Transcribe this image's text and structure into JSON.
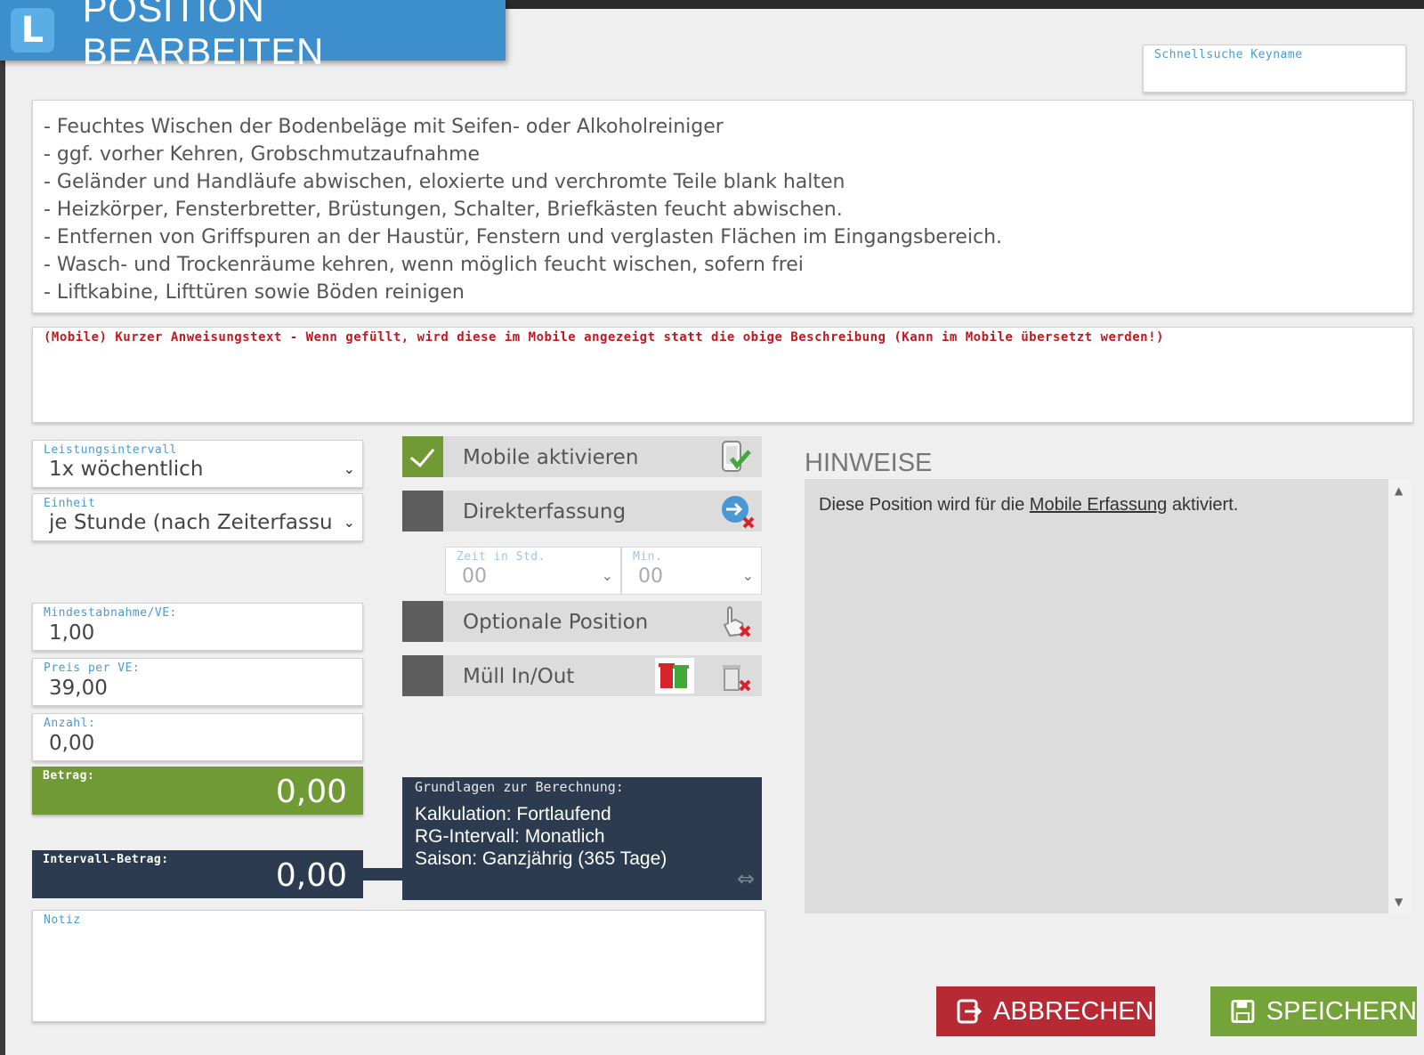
{
  "header": {
    "logo": "L",
    "title": "POSITION BEARBEITEN"
  },
  "search": {
    "label": "Schnellsuche Keyname",
    "value": ""
  },
  "description": {
    "lines": [
      "- Feuchtes Wischen der Bodenbeläge mit Seifen- oder Alkoholreiniger",
      "- ggf. vorher Kehren, Grobschmutzaufnahme",
      "- Geländer und Handläufe abwischen, eloxierte und verchromte Teile blank halten",
      "- Heizkörper, Fensterbretter, Brüstungen, Schalter, Briefkästen feucht abwischen.",
      "- Entfernen von Griffspuren an der Haustür, Fenstern und verglasten Flächen im Eingangsbereich.",
      "- Wasch- und Trockenräume kehren, wenn möglich feucht wischen, sofern frei",
      "- Liftkabine, Lifttüren sowie Böden reinigen"
    ]
  },
  "mobile_text": {
    "label": "(Mobile) Kurzer Anweisungstext - Wenn gefüllt, wird diese im Mobile angezeigt statt die obige Beschreibung (Kann im Mobile übersetzt werden!)",
    "value": ""
  },
  "form": {
    "leistungsintervall": {
      "label": "Leistungsintervall",
      "value": "1x wöchentlich"
    },
    "einheit": {
      "label": "Einheit",
      "value": "je Stunde (nach Zeiterfassur"
    },
    "mindestabnahme": {
      "label": "Mindestabnahme/VE:",
      "value": "1,00"
    },
    "preis": {
      "label": "Preis per VE:",
      "value": "39,00"
    },
    "anzahl": {
      "label": "Anzahl:",
      "value": "0,00"
    },
    "betrag": {
      "label": "Betrag:",
      "value": "0,00"
    },
    "intervall_betrag": {
      "label": "Intervall-Betrag:",
      "value": "0,00"
    },
    "notiz": {
      "label": "Notiz",
      "value": ""
    }
  },
  "toggles": {
    "mobile": {
      "label": "Mobile aktivieren",
      "checked": true
    },
    "direkt": {
      "label": "Direkterfassung",
      "checked": false
    },
    "optional": {
      "label": "Optionale Position",
      "checked": false
    },
    "muell": {
      "label": "Müll In/Out",
      "checked": false
    }
  },
  "time": {
    "hours": {
      "label": "Zeit in Std.",
      "value": "00"
    },
    "minutes": {
      "label": "Min.",
      "value": "00"
    }
  },
  "calculation": {
    "title": "Grundlagen zur Berechnung:",
    "lines": [
      "Kalkulation: Fortlaufend",
      "RG-Intervall: Monatlich",
      "Saison: Ganzjährig (365 Tage)"
    ]
  },
  "hinweise": {
    "title": "HINWEISE",
    "text_before": "Diese Position wird für die ",
    "link": "Mobile Erfassung",
    "text_after": " aktiviert."
  },
  "buttons": {
    "cancel": "ABBRECHEN",
    "save": "SPEICHERN"
  },
  "colors": {
    "brand": "#3c8fcc",
    "green": "#6f9a34",
    "navy": "#2c3b4f",
    "red": "#b72a33"
  }
}
